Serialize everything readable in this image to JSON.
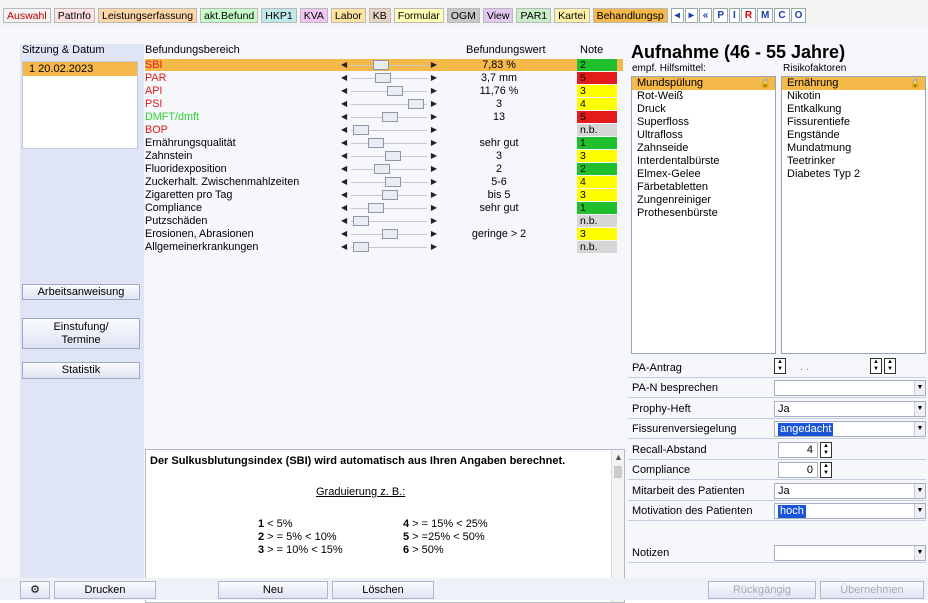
{
  "tabs": [
    {
      "label": "Auswahl",
      "bg": "#f4f4f4",
      "color": "#c00000"
    },
    {
      "label": "PatInfo",
      "bg": "#ffe2e2",
      "color": "#000"
    },
    {
      "label": "Leistungserfassung",
      "bg": "#ffd7a8",
      "color": "#000"
    },
    {
      "label": "akt.Befund",
      "bg": "#c8ffc8",
      "color": "#000"
    },
    {
      "label": "HKP1",
      "bg": "#bfe9e9",
      "color": "#000"
    },
    {
      "label": "KVA",
      "bg": "#f2c4f2",
      "color": "#000"
    },
    {
      "label": "Labor",
      "bg": "#ffe4a0",
      "color": "#000"
    },
    {
      "label": "KB",
      "bg": "#e6d3c2",
      "color": "#000"
    },
    {
      "label": "Formular",
      "bg": "#ffffb5",
      "color": "#000"
    },
    {
      "label": "OGM",
      "bg": "#c7c7c7",
      "color": "#000"
    },
    {
      "label": "View",
      "bg": "#e0c8f0",
      "color": "#000"
    },
    {
      "label": "PAR1",
      "bg": "#c8eec8",
      "color": "#000"
    },
    {
      "label": "Kartei",
      "bg": "#fff2a8",
      "color": "#000"
    },
    {
      "label": "Behandlungsp",
      "bg": "#f5b94a",
      "color": "#000"
    }
  ],
  "tabctrls": [
    "◂",
    "▸",
    "«",
    "P",
    "I",
    "R",
    "M",
    "C",
    "O"
  ],
  "left": {
    "header": "Sitzung & Datum",
    "session": "1  20.02.2023",
    "buttons": [
      "Arbeitsanweisung",
      "Einstufung/ Termine",
      "Statistik"
    ]
  },
  "grid": {
    "h_name": "Befundungsbereich",
    "h_value": "Befundungswert",
    "h_note": "Note",
    "rows": [
      {
        "name": "SBI",
        "value": "7,83 %",
        "note": "2",
        "color": "#e01818",
        "notebg": "#1fbf2e",
        "sel": true,
        "thumb": 0.36
      },
      {
        "name": "PAR",
        "value": "3,7 mm",
        "note": "5",
        "color": "#e01818",
        "notebg": "#e31b1b",
        "sel": false,
        "thumb": 0.4
      },
      {
        "name": "API",
        "value": "11,76 %",
        "note": "3",
        "color": "#e01818",
        "notebg": "#ffff00",
        "sel": false,
        "thumb": 0.6
      },
      {
        "name": "PSI",
        "value": "3",
        "note": "4",
        "color": "#e01818",
        "notebg": "#ffff00",
        "sel": false,
        "thumb": 0.95
      },
      {
        "name": "DMFT/dmft",
        "value": "13",
        "note": "5",
        "color": "#2fd22f",
        "notebg": "#e31b1b",
        "sel": false,
        "thumb": 0.52
      },
      {
        "name": "BOP",
        "value": "",
        "note": "n.b.",
        "color": "#e01818",
        "notebg": "#d6d6d6",
        "sel": false,
        "thumb": 0.04
      },
      {
        "name": "Ernährungsqualität",
        "value": "sehr gut",
        "note": "1",
        "color": "#000",
        "notebg": "#1fbf2e",
        "sel": false,
        "thumb": 0.28
      },
      {
        "name": "Zahnstein",
        "value": "3",
        "note": "3",
        "color": "#000",
        "notebg": "#ffff00",
        "sel": false,
        "thumb": 0.57
      },
      {
        "name": "Fluoridexposition",
        "value": "2",
        "note": "2",
        "color": "#000",
        "notebg": "#1fbf2e",
        "sel": false,
        "thumb": 0.38
      },
      {
        "name": "Zuckerhalt. Zwischenmahlzeiten",
        "value": "5-6",
        "note": "4",
        "color": "#000",
        "notebg": "#ffff00",
        "sel": false,
        "thumb": 0.57
      },
      {
        "name": "Zigaretten pro Tag",
        "value": "bis 5",
        "note": "3",
        "color": "#000",
        "notebg": "#ffff00",
        "sel": false,
        "thumb": 0.52
      },
      {
        "name": "Compliance",
        "value": "sehr gut",
        "note": "1",
        "color": "#000",
        "notebg": "#1fbf2e",
        "sel": false,
        "thumb": 0.28
      },
      {
        "name": "Putzschäden",
        "value": "",
        "note": "n.b.",
        "color": "#000",
        "notebg": "#d6d6d6",
        "sel": false,
        "thumb": 0.04
      },
      {
        "name": "Erosionen, Abrasionen",
        "value": "geringe > 2",
        "note": "3",
        "color": "#000",
        "notebg": "#ffff00",
        "sel": false,
        "thumb": 0.52
      },
      {
        "name": "Allgemeinerkrankungen",
        "value": "",
        "note": "n.b.",
        "color": "#000",
        "notebg": "#d6d6d6",
        "sel": false,
        "thumb": 0.04
      }
    ]
  },
  "info": {
    "title": "Der Sulkusblutungsindex (SBI) wird automatisch aus Ihren Angaben berechnet.",
    "grad_title": "Graduierung z. B.:",
    "grades": [
      {
        "num": "1",
        "text": " < 5%"
      },
      {
        "num": "2",
        "text": " > = 5% < 10%"
      },
      {
        "num": "3",
        "text": " > = 10% < 15%"
      },
      {
        "num": "4",
        "text": " > = 15% < 25%"
      },
      {
        "num": "5",
        "text": " > =25% < 50%"
      },
      {
        "num": "6",
        "text": " > 50%"
      }
    ]
  },
  "right": {
    "title": "Aufnahme (46 - 55 Jahre)",
    "sub1": "empf. Hilfsmittel:",
    "sub2": "Risikofaktoren",
    "hilfsmittel": [
      "Mundspülung",
      "Rot-Weiß",
      "Druck",
      "Superfloss",
      "Ultrafloss",
      "Zahnseide",
      "Interdentalbürste",
      "Elmex-Gelee",
      "Färbetabletten",
      "Zungenreiniger",
      "Prothesenbürste"
    ],
    "risiko": [
      "Ernährung",
      "Nikotin",
      "Entkalkung",
      "Fissurentiefe",
      "Engstände",
      "Mundatmung",
      "Teetrinker",
      "Diabetes Typ 2"
    ],
    "lock_glyph": "🔒",
    "form": [
      {
        "label": "PA-Antrag",
        "value": "  .  .",
        "kind": "date"
      },
      {
        "label": "PA-N besprechen",
        "value": "",
        "kind": "dd"
      },
      {
        "label": "Prophy-Heft",
        "value": "Ja",
        "kind": "dd"
      },
      {
        "label": "Fissurenversiegelung",
        "value": "angedacht",
        "kind": "dd-hl"
      },
      {
        "label": "Recall-Abstand",
        "value": "4",
        "kind": "spin"
      },
      {
        "label": "Compliance",
        "value": "0",
        "kind": "spin"
      },
      {
        "label": "Mitarbeit des Patienten",
        "value": "Ja",
        "kind": "dd"
      },
      {
        "label": "Motivation des Patienten",
        "value": "hoch",
        "kind": "dd-hl"
      },
      {
        "label": "Notizen",
        "value": "",
        "kind": "dd-notes"
      }
    ]
  },
  "bottom": {
    "gear": "⚙",
    "print": "Drucken",
    "neu": "Neu",
    "loeschen": "Löschen",
    "undo": "Rückgängig",
    "apply": "Übernehmen"
  }
}
